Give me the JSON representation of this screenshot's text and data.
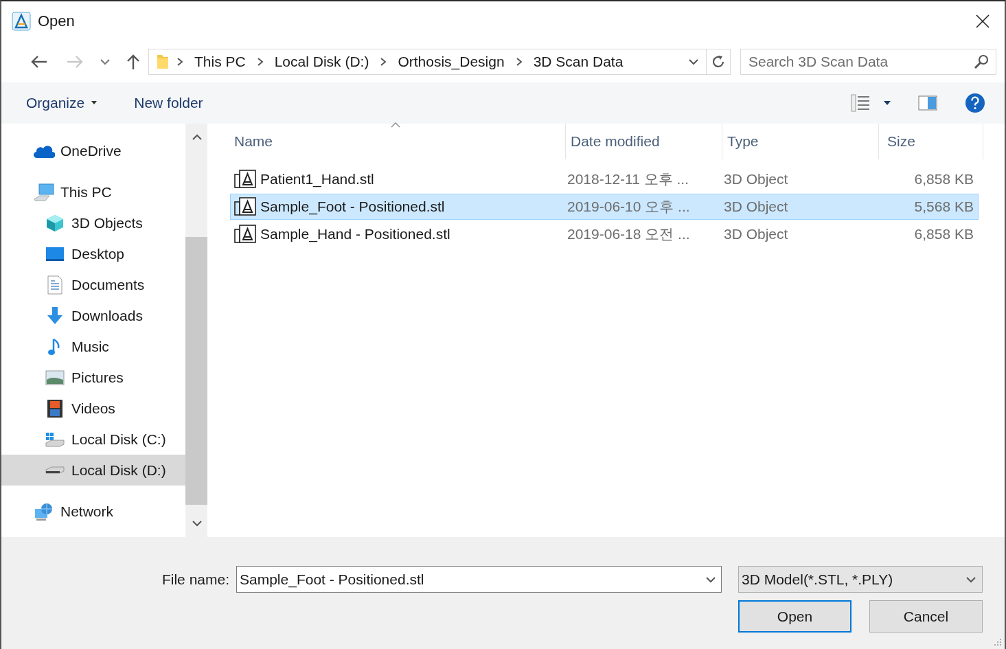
{
  "window": {
    "title": "Open"
  },
  "navigation": {
    "breadcrumbs": [
      "This PC",
      "Local Disk (D:)",
      "Orthosis_Design",
      "3D Scan Data"
    ],
    "search": {
      "placeholder": "Search 3D Scan Data"
    }
  },
  "toolbar": {
    "buttons": [
      "Organize",
      "New folder"
    ]
  },
  "sidebar": {
    "items": [
      {
        "label": "OneDrive",
        "selected": false
      },
      {
        "label": "This PC",
        "selected": false,
        "children": [
          {
            "label": "3D Objects",
            "selected": false
          },
          {
            "label": "Desktop",
            "selected": false
          },
          {
            "label": "Documents",
            "selected": false
          },
          {
            "label": "Downloads",
            "selected": false
          },
          {
            "label": "Music",
            "selected": false
          },
          {
            "label": "Pictures",
            "selected": false
          },
          {
            "label": "Videos",
            "selected": false
          },
          {
            "label": "Local Disk (C:)",
            "selected": false
          },
          {
            "label": "Local Disk (D:)",
            "selected": true
          }
        ]
      },
      {
        "label": "Network",
        "selected": false
      }
    ]
  },
  "file_list": {
    "columns": [
      "Name",
      "Date modified",
      "Type",
      "Size"
    ],
    "rows": [
      {
        "name": "Patient1_Hand.stl",
        "date": "2018-12-11 오후 ...",
        "type": "3D Object",
        "size": "6,858 KB",
        "selected": false
      },
      {
        "name": "Sample_Foot - Positioned.stl",
        "date": "2019-06-10 오후 ...",
        "type": "3D Object",
        "size": "5,568 KB",
        "selected": true
      },
      {
        "name": "Sample_Hand - Positioned.stl",
        "date": "2019-06-18 오전 ...",
        "type": "3D Object",
        "size": "6,858 KB",
        "selected": false
      }
    ]
  },
  "footer": {
    "file_name_label": "File name:",
    "file_name": "Sample_Foot - Positioned.stl",
    "filter": "3D Model(*.STL, *.PLY)",
    "buttons": [
      {
        "label": "Open",
        "default": true
      },
      {
        "label": "Cancel",
        "default": false
      }
    ]
  }
}
